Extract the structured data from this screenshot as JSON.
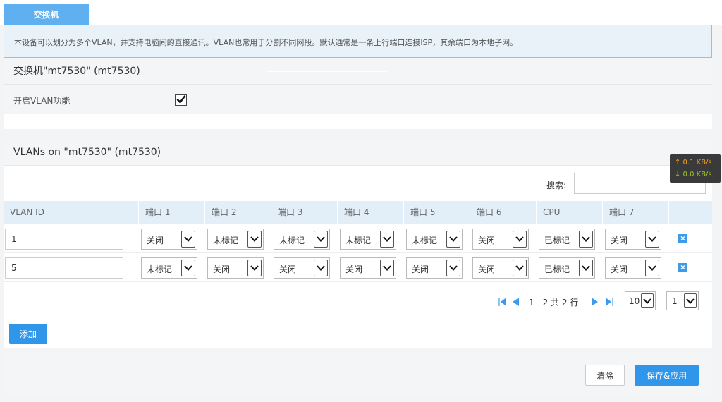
{
  "tab": {
    "label": "交换机"
  },
  "notice": {
    "text": "本设备可以划分为多个VLAN，并支持电脑间的直接通讯。VLAN也常用于分割不同网段。默认通常是一条上行端口连接ISP，其余端口为本地子网。"
  },
  "switch_panel": {
    "title": "交换机\"mt7530\" (mt7530)",
    "enable_vlan_label": "开启VLAN功能",
    "enable_vlan_checked": true
  },
  "vlans_panel": {
    "title": "VLANs on \"mt7530\" (mt7530)",
    "search_label": "搜索:",
    "search_value": "",
    "columns": [
      "VLAN ID",
      "端口 1",
      "端口 2",
      "端口 3",
      "端口 4",
      "端口 5",
      "端口 6",
      "CPU",
      "端口 7"
    ],
    "rows": [
      {
        "vlan_id": "1",
        "ports": [
          "关闭",
          "未标记",
          "未标记",
          "未标记",
          "未标记",
          "关闭",
          "已标记",
          "关闭"
        ]
      },
      {
        "vlan_id": "5",
        "ports": [
          "未标记",
          "关闭",
          "关闭",
          "关闭",
          "关闭",
          "关闭",
          "已标记",
          "关闭"
        ]
      }
    ],
    "delete_icon": "×",
    "pager_text": "1 - 2 共 2 行",
    "page_size": "10",
    "page_number": "1",
    "add_label": "添加"
  },
  "footer": {
    "clear_label": "清除",
    "save_label": "保存&应用"
  },
  "speed_widget": {
    "up": "↑ 0.1 KB/s",
    "down": "↓ 0.0 KB/s"
  },
  "colors": {
    "accent": "#2f96ea",
    "tab": "#5fb0f0",
    "header_bg": "#e2eef8",
    "notice_border": "#8cc4ee"
  }
}
